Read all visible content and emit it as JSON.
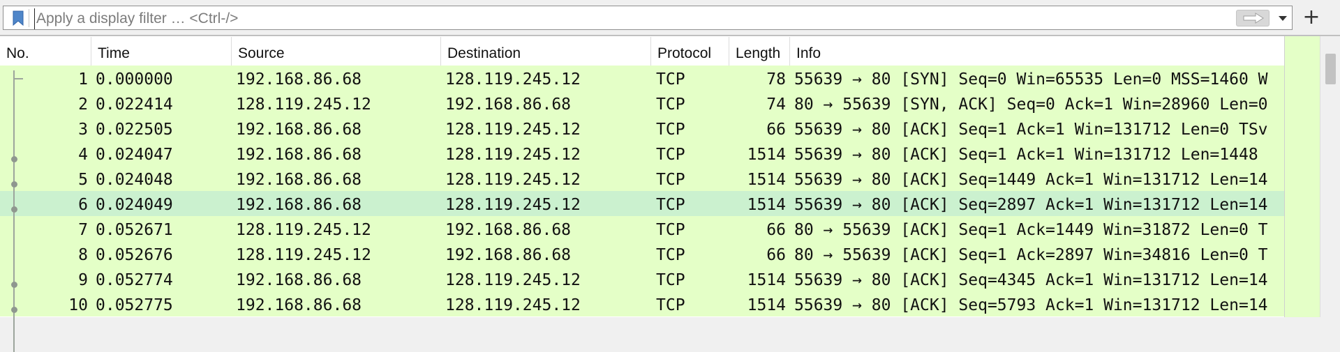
{
  "filter": {
    "placeholder": "Apply a display filter … <Ctrl-/>",
    "value": "",
    "bookmark_icon": "bookmark-icon",
    "apply_icon": "arrow-right-icon",
    "dropdown_icon": "chevron-down-icon",
    "add_button_label": "+"
  },
  "columns": [
    "No.",
    "Time",
    "Source",
    "Destination",
    "Protocol",
    "Length",
    "Info"
  ],
  "packets": [
    {
      "no": "1",
      "time": "0.000000",
      "source": "192.168.86.68",
      "destination": "128.119.245.12",
      "protocol": "TCP",
      "length": "78",
      "info": "55639 → 80 [SYN] Seq=0 Win=65535 Len=0 MSS=1460 W"
    },
    {
      "no": "2",
      "time": "0.022414",
      "source": "128.119.245.12",
      "destination": "192.168.86.68",
      "protocol": "TCP",
      "length": "74",
      "info": "80 → 55639 [SYN, ACK] Seq=0 Ack=1 Win=28960 Len=0"
    },
    {
      "no": "3",
      "time": "0.022505",
      "source": "192.168.86.68",
      "destination": "128.119.245.12",
      "protocol": "TCP",
      "length": "66",
      "info": "55639 → 80 [ACK] Seq=1 Ack=1 Win=131712 Len=0 TSv"
    },
    {
      "no": "4",
      "time": "0.024047",
      "source": "192.168.86.68",
      "destination": "128.119.245.12",
      "protocol": "TCP",
      "length": "1514",
      "info": "55639 → 80 [ACK] Seq=1 Ack=1 Win=131712 Len=1448"
    },
    {
      "no": "5",
      "time": "0.024048",
      "source": "192.168.86.68",
      "destination": "128.119.245.12",
      "protocol": "TCP",
      "length": "1514",
      "info": "55639 → 80 [ACK] Seq=1449 Ack=1 Win=131712 Len=14"
    },
    {
      "no": "6",
      "time": "0.024049",
      "source": "192.168.86.68",
      "destination": "128.119.245.12",
      "protocol": "TCP",
      "length": "1514",
      "info": "55639 → 80 [ACK] Seq=2897 Ack=1 Win=131712 Len=14"
    },
    {
      "no": "7",
      "time": "0.052671",
      "source": "128.119.245.12",
      "destination": "192.168.86.68",
      "protocol": "TCP",
      "length": "66",
      "info": "80 → 55639 [ACK] Seq=1 Ack=1449 Win=31872 Len=0 T"
    },
    {
      "no": "8",
      "time": "0.052676",
      "source": "128.119.245.12",
      "destination": "192.168.86.68",
      "protocol": "TCP",
      "length": "66",
      "info": "80 → 55639 [ACK] Seq=1 Ack=2897 Win=34816 Len=0 T"
    },
    {
      "no": "9",
      "time": "0.052774",
      "source": "192.168.86.68",
      "destination": "128.119.245.12",
      "protocol": "TCP",
      "length": "1514",
      "info": "55639 → 80 [ACK] Seq=4345 Ack=1 Win=131712 Len=14"
    },
    {
      "no": "10",
      "time": "0.052775",
      "source": "192.168.86.68",
      "destination": "128.119.245.12",
      "protocol": "TCP",
      "length": "1514",
      "info": "55639 → 80 [ACK] Seq=5793 Ack=1 Win=131712 Len=14"
    }
  ],
  "selected_packet": "6",
  "colors": {
    "tcp_row": "#e4ffc7",
    "selected_row": "#cbf1cf"
  }
}
